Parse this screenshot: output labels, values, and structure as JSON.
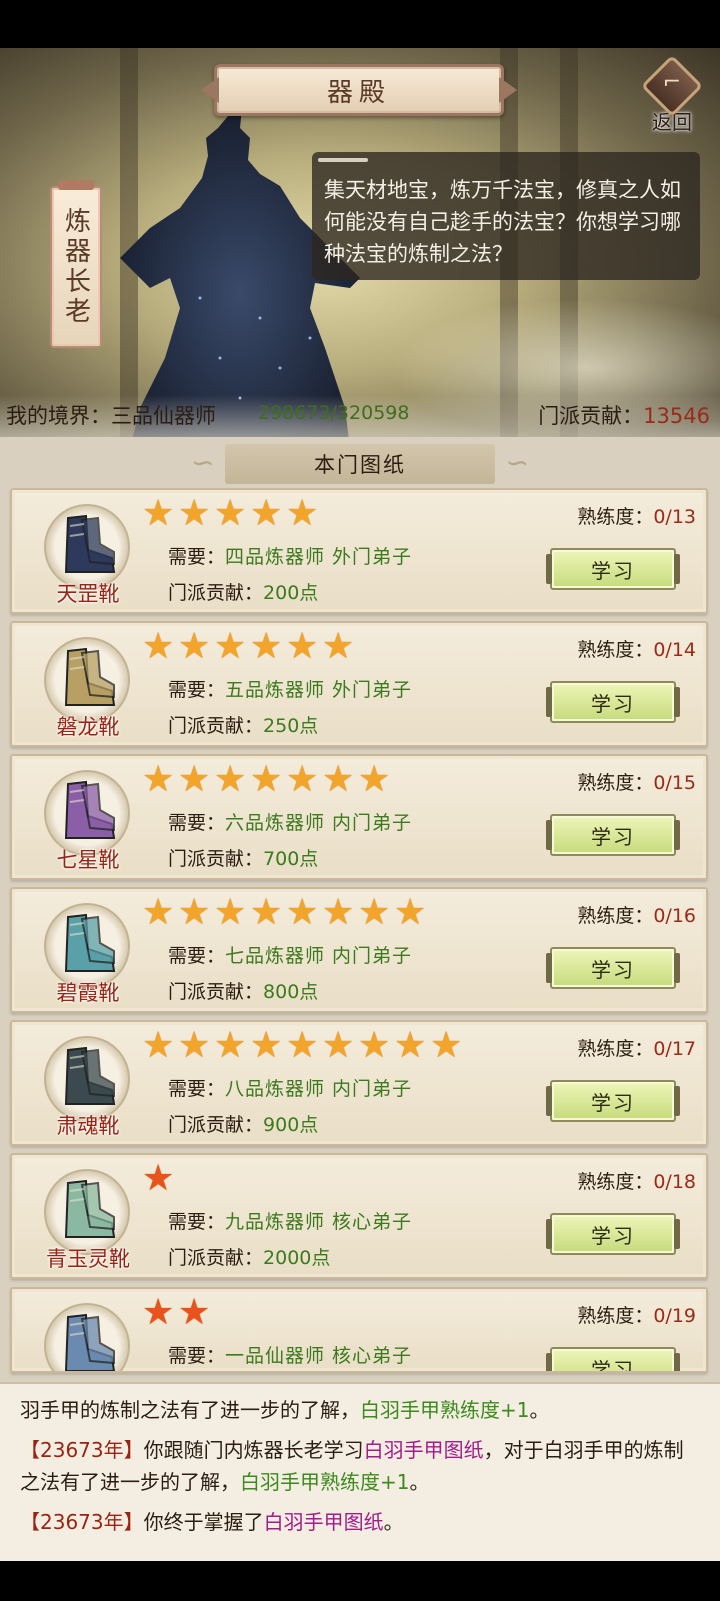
{
  "header": {
    "title": "器殿",
    "back_label": "返回",
    "back_glyph": "⌐"
  },
  "npc": {
    "name": "炼器长老",
    "dialog": "集天材地宝，炼万千法宝，修真之人如何能没有自己趁手的法宝？你想学习哪种法宝的炼制之法？"
  },
  "status": {
    "realm_label": "我的境界：三品仙器师",
    "realm_progress": "298673/320598",
    "contrib_label": "门派贡献：",
    "contrib_value": "13546"
  },
  "section": {
    "title": "本门图纸"
  },
  "labels": {
    "proficiency": "熟练度：",
    "require": "需要：",
    "contribution": "门派贡献：",
    "learn": "学习"
  },
  "items": [
    {
      "name": "天罡靴",
      "stars": 5,
      "star_color": "gold",
      "proficiency": "0/13",
      "require": "四品炼器师  外门弟子",
      "cost": "200点",
      "boot_color": "#2d3a5c"
    },
    {
      "name": "磐龙靴",
      "stars": 6,
      "star_color": "gold",
      "proficiency": "0/14",
      "require": "五品炼器师  外门弟子",
      "cost": "250点",
      "boot_color": "#b8a064"
    },
    {
      "name": "七星靴",
      "stars": 7,
      "star_color": "gold",
      "proficiency": "0/15",
      "require": "六品炼器师  内门弟子",
      "cost": "700点",
      "boot_color": "#8a5fa8"
    },
    {
      "name": "碧霞靴",
      "stars": 8,
      "star_color": "gold",
      "proficiency": "0/16",
      "require": "七品炼器师  内门弟子",
      "cost": "800点",
      "boot_color": "#5aa0a8"
    },
    {
      "name": "肃魂靴",
      "stars": 9,
      "star_color": "gold",
      "proficiency": "0/17",
      "require": "八品炼器师  内门弟子",
      "cost": "900点",
      "boot_color": "#3a4a4e"
    },
    {
      "name": "青玉灵靴",
      "stars": 1,
      "star_color": "red",
      "proficiency": "0/18",
      "require": "九品炼器师  核心弟子",
      "cost": "2000点",
      "boot_color": "#8ab8a0"
    },
    {
      "name": "",
      "stars": 2,
      "star_color": "red",
      "proficiency": "0/19",
      "require": "一品仙器师  核心弟子",
      "cost": "",
      "boot_color": "#6a8ab0"
    }
  ],
  "log": [
    {
      "parts": [
        {
          "t": "羽手甲的炼制之法有了进一步的了解，",
          "c": ""
        },
        {
          "t": "白羽手甲熟练度+1",
          "c": "green"
        },
        {
          "t": "。",
          "c": ""
        }
      ]
    },
    {
      "parts": [
        {
          "t": "【23673年】",
          "c": "year"
        },
        {
          "t": "你跟随门内炼器长老学习",
          "c": ""
        },
        {
          "t": "白羽手甲图纸",
          "c": "purple"
        },
        {
          "t": "，对于白羽手甲的炼制之法有了进一步的了解，",
          "c": ""
        },
        {
          "t": "白羽手甲熟练度+1",
          "c": "green"
        },
        {
          "t": "。",
          "c": ""
        }
      ]
    },
    {
      "parts": [
        {
          "t": "【23673年】",
          "c": "year"
        },
        {
          "t": "你终于掌握了",
          "c": ""
        },
        {
          "t": "白羽手甲图纸",
          "c": "purple"
        },
        {
          "t": "。",
          "c": ""
        }
      ]
    }
  ]
}
